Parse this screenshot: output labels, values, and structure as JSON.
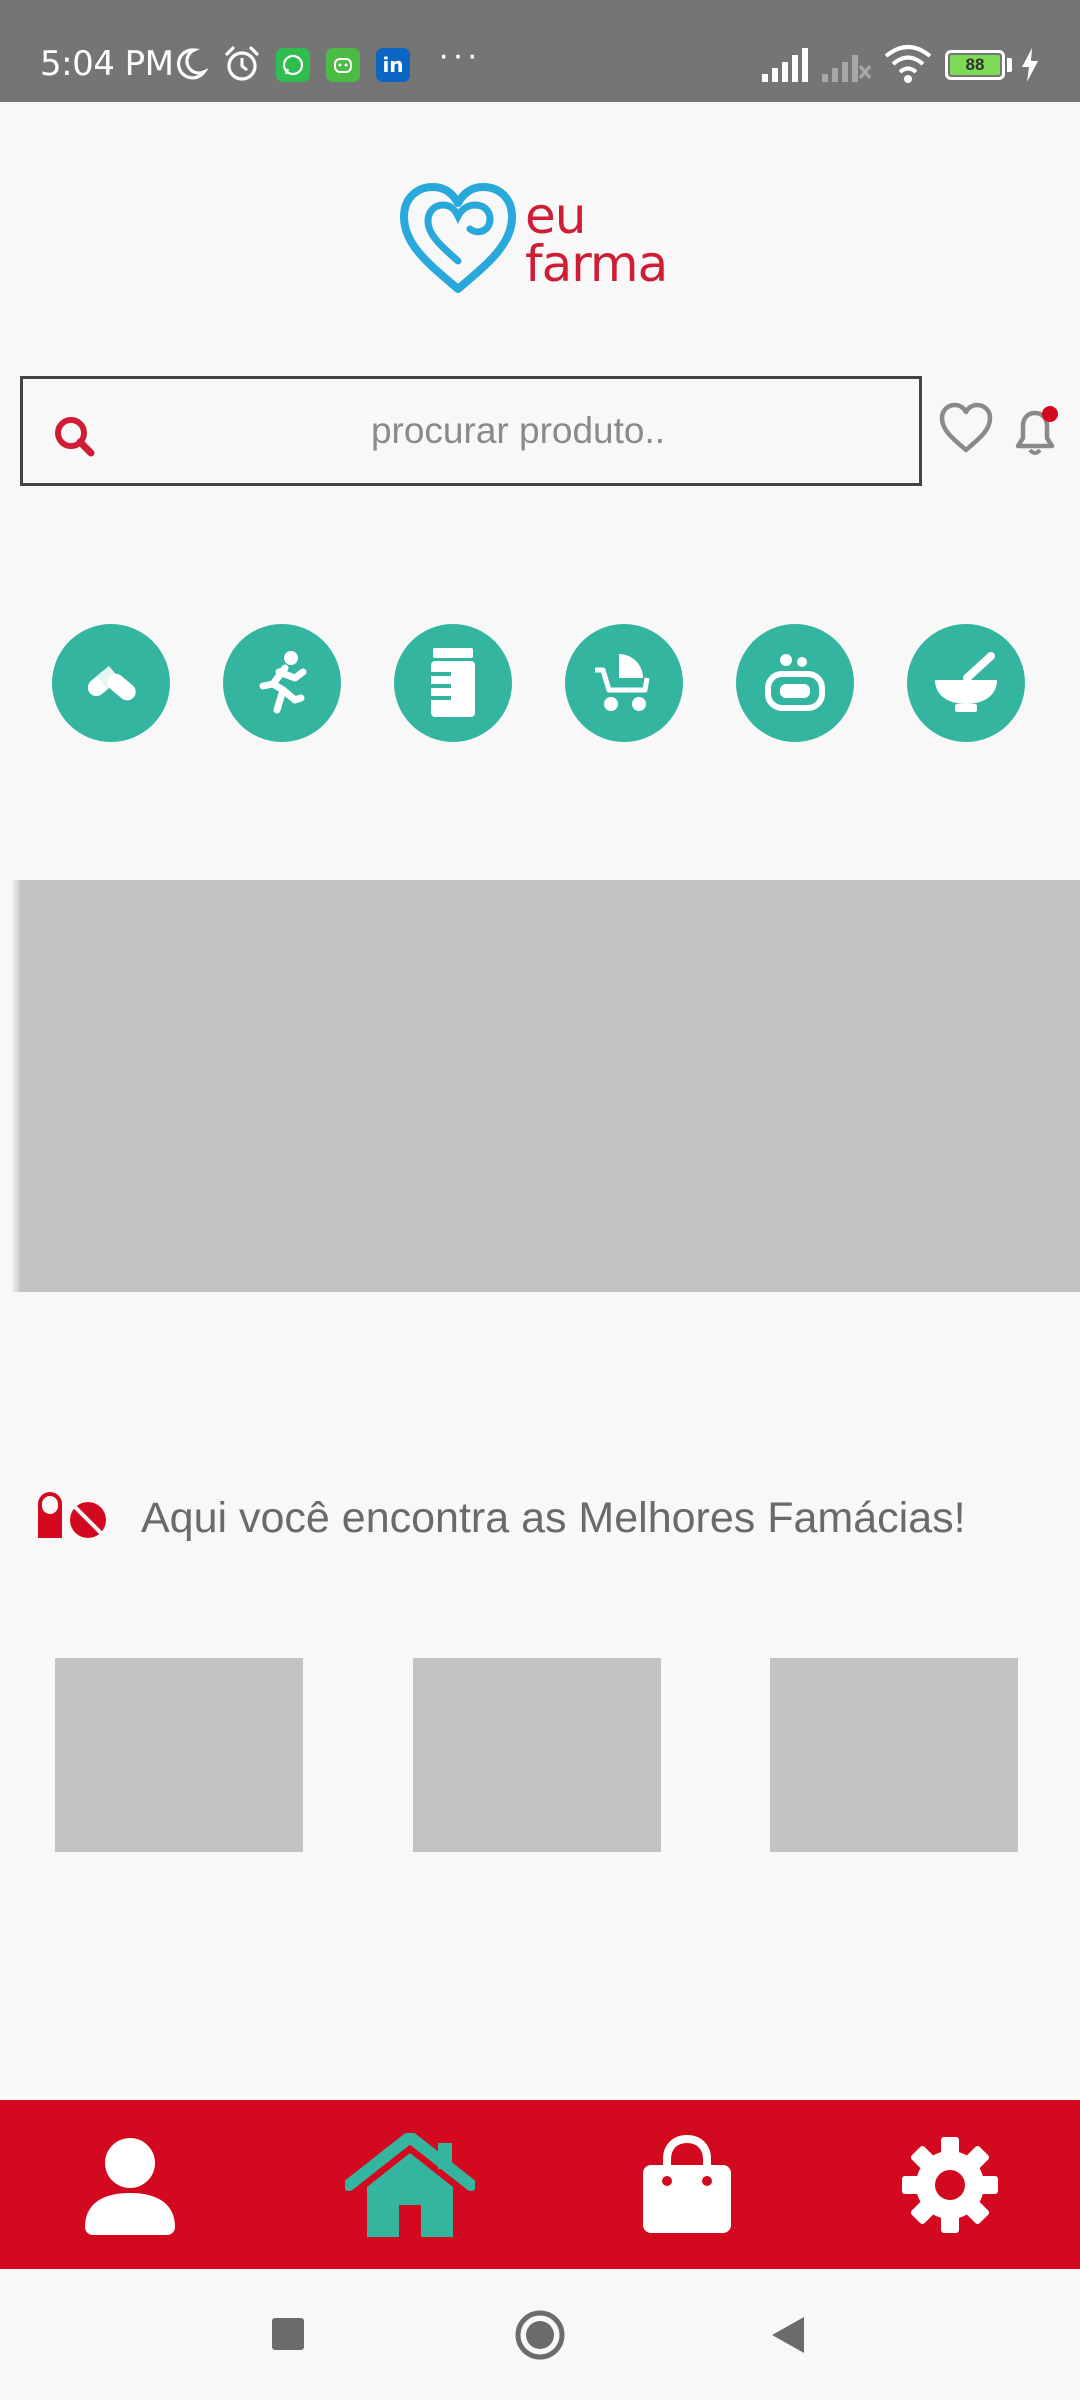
{
  "status_bar": {
    "time": "5:04 PM",
    "icons": [
      "moon-icon",
      "alarm-icon",
      "whatsapp-icon",
      "chat-app-icon",
      "linkedin-icon",
      "more-icon",
      "signal-icon",
      "signal-off-icon",
      "wifi-icon",
      "battery-icon",
      "charging-icon"
    ],
    "app_badges": {
      "linkedin": "in"
    },
    "more": "···",
    "battery_level": "88"
  },
  "header": {
    "logo_line1": "eu",
    "logo_line2": "farma",
    "brand_colors": {
      "heart": "#29a8dc",
      "text": "#cf1d36"
    }
  },
  "search": {
    "placeholder": "procurar produto.."
  },
  "categories": [
    {
      "icon": "pills-icon"
    },
    {
      "icon": "running-icon"
    },
    {
      "icon": "supplement-jar-icon"
    },
    {
      "icon": "baby-stroller-icon"
    },
    {
      "icon": "soap-icon"
    },
    {
      "icon": "mortar-pestle-icon"
    }
  ],
  "section": {
    "title": "Aqui você encontra as Melhores Famácias!"
  },
  "bottom_nav": [
    {
      "icon": "user-icon",
      "active": false
    },
    {
      "icon": "home-icon",
      "active": true
    },
    {
      "icon": "shopping-bag-icon",
      "active": false
    },
    {
      "icon": "gear-icon",
      "active": false
    }
  ],
  "colors": {
    "accent_red": "#d30a1f",
    "accent_teal": "#33b59f",
    "placeholder_gray": "#c3c3c3"
  }
}
